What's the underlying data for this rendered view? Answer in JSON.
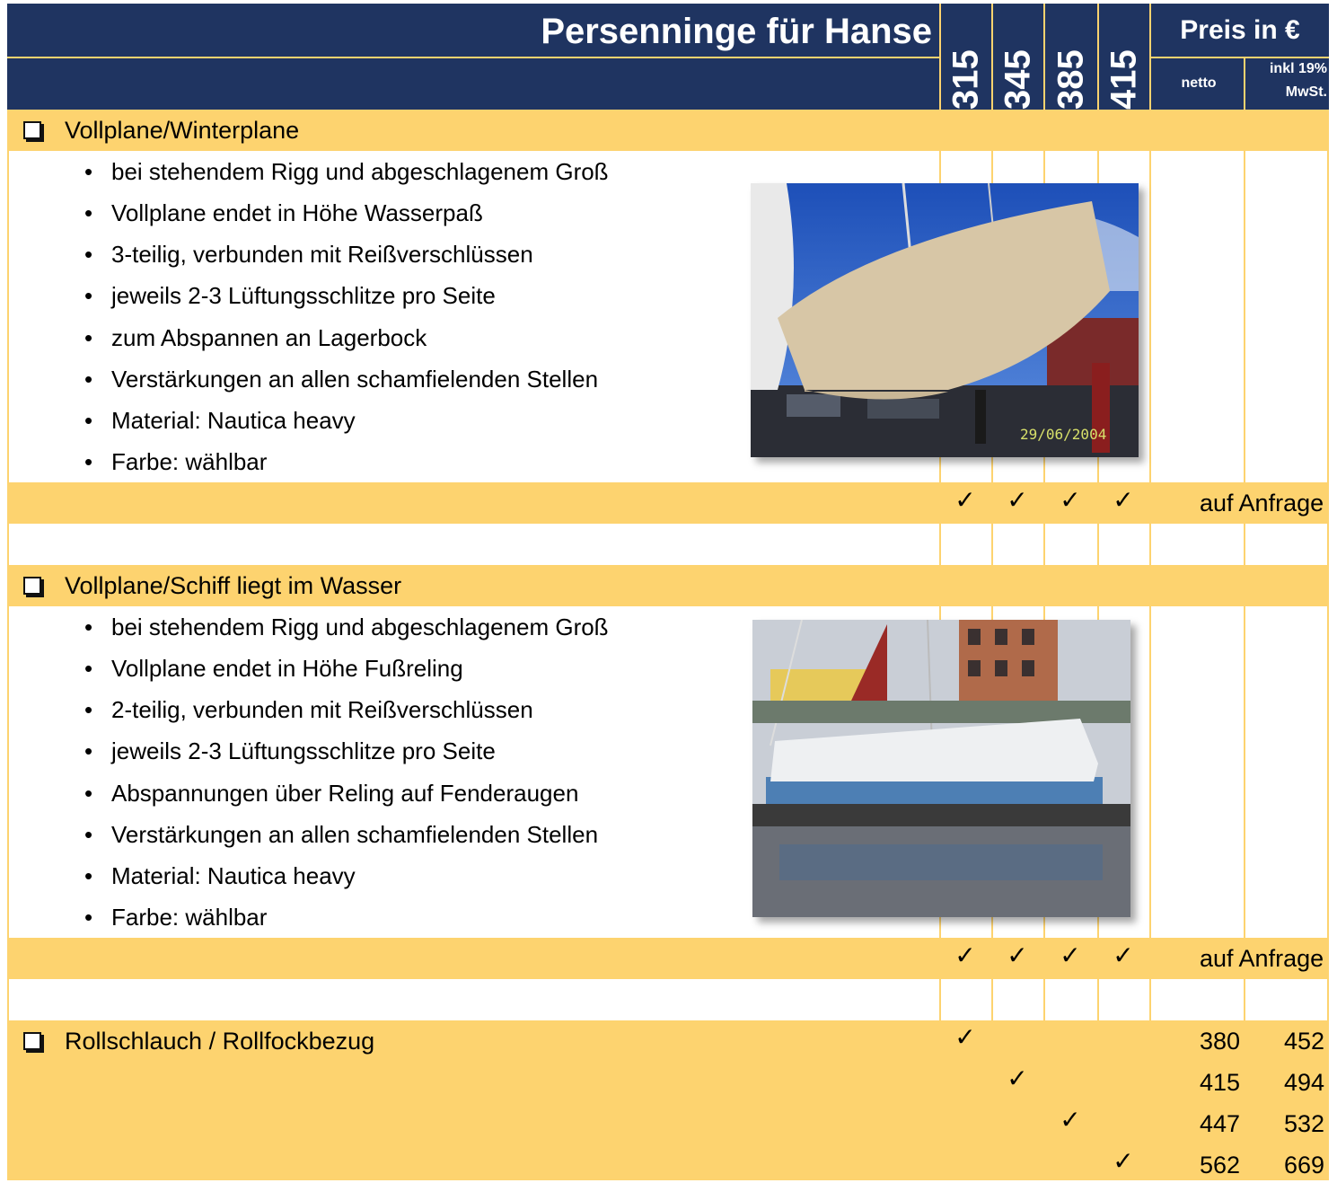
{
  "header": {
    "title": "Persenninge für Hanse",
    "models": [
      "315",
      "345",
      "385",
      "415"
    ],
    "price_title": "Preis in €",
    "netto_label": "netto",
    "brutto_label_1": "inkl 19%",
    "brutto_label_2": "MwSt."
  },
  "sections": [
    {
      "title": "Vollplane/Winterplane",
      "bullets": [
        "bei stehendem Rigg und abgeschlagenem Groß",
        "Vollplane endet in Höhe Wasserpaß",
        "3-teilig, verbunden mit Reißverschlüssen",
        "jeweils 2-3 Lüftungsschlitze pro Seite",
        "zum Abspannen an Lagerbock",
        "Verstärkungen an allen schamfielenden Stellen",
        "Material: Nautica heavy",
        "Farbe: wählbar"
      ],
      "photo_date": "29/06/2004",
      "checks": [
        "✓",
        "✓",
        "✓",
        "✓"
      ],
      "price": "auf Anfrage"
    },
    {
      "title": "Vollplane/Schiff liegt im Wasser",
      "bullets": [
        "bei stehendem Rigg und abgeschlagenem Groß",
        "Vollplane endet in Höhe Fußreling",
        "2-teilig, verbunden mit Reißverschlüssen",
        "jeweils 2-3 Lüftungsschlitze pro Seite",
        "Abspannungen über Reling auf Fenderaugen",
        "Verstärkungen an allen schamfielenden Stellen",
        "Material: Nautica heavy",
        "Farbe: wählbar"
      ],
      "checks": [
        "✓",
        "✓",
        "✓",
        "✓"
      ],
      "price": "auf Anfrage"
    },
    {
      "title": "Rollschlauch / Rollfockbezug",
      "rows": [
        {
          "model": "315",
          "check": "✓",
          "netto": "380",
          "brutto": "452"
        },
        {
          "model": "345",
          "check": "✓",
          "netto": "415",
          "brutto": "494"
        },
        {
          "model": "385",
          "check": "✓",
          "netto": "447",
          "brutto": "532"
        },
        {
          "model": "415",
          "check": "✓",
          "netto": "562",
          "brutto": "669"
        }
      ]
    }
  ],
  "colors": {
    "navy": "#1f3461",
    "gold": "#fdd36f",
    "border": "#fdd36f"
  },
  "icons": {
    "section_checkbox": "checkbox-icon",
    "bullet": "bullet-icon",
    "check": "checkmark-icon"
  }
}
